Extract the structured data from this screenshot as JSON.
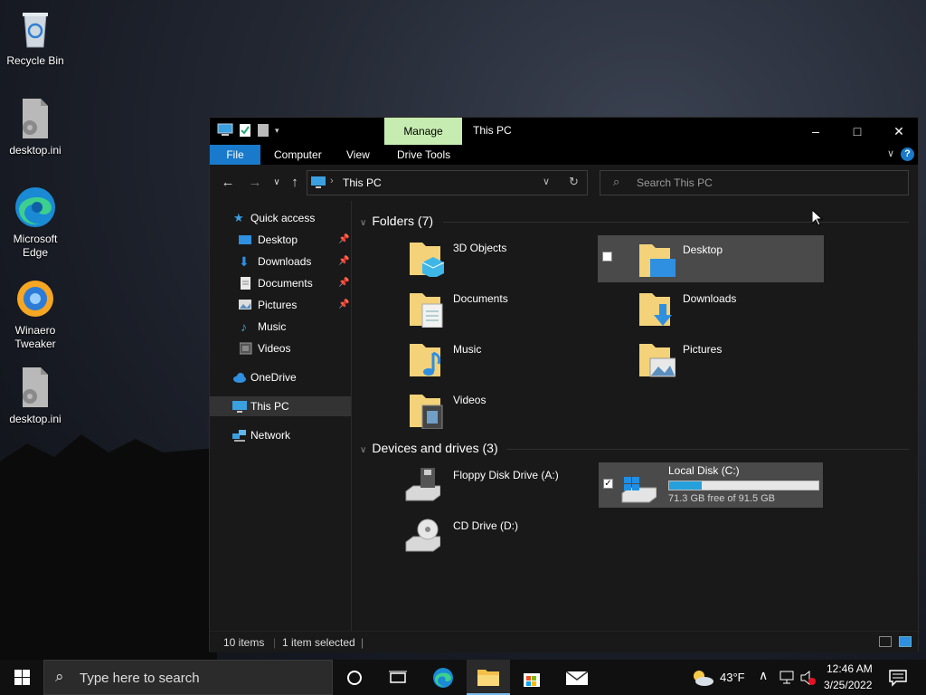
{
  "desktop": {
    "icons": [
      {
        "label": "Recycle Bin",
        "icon": "recycle-bin-icon"
      },
      {
        "label": "desktop.ini",
        "icon": "settings-file-icon"
      },
      {
        "label": "Microsoft Edge",
        "icon": "edge-icon"
      },
      {
        "label": "Winaero Tweaker",
        "icon": "winaero-icon"
      },
      {
        "label": "desktop.ini",
        "icon": "settings-file-icon"
      }
    ]
  },
  "window": {
    "context_tab": "Manage",
    "title": "This PC",
    "ribbon_tabs": [
      "File",
      "Computer",
      "View",
      "Drive Tools"
    ],
    "help_label": "?",
    "address": "This PC",
    "search_placeholder": "Search This PC"
  },
  "navpane": {
    "quick_access": "Quick access",
    "quick_items": [
      {
        "label": "Desktop",
        "pinned": true
      },
      {
        "label": "Downloads",
        "pinned": true
      },
      {
        "label": "Documents",
        "pinned": true
      },
      {
        "label": "Pictures",
        "pinned": true
      },
      {
        "label": "Music",
        "pinned": false
      },
      {
        "label": "Videos",
        "pinned": false
      }
    ],
    "onedrive": "OneDrive",
    "this_pc": "This PC",
    "network": "Network"
  },
  "content": {
    "folders_header": "Folders (7)",
    "folders": [
      "3D Objects",
      "Desktop",
      "Documents",
      "Downloads",
      "Music",
      "Pictures",
      "Videos"
    ],
    "selected_folder": "Desktop",
    "drives_header": "Devices and drives (3)",
    "drives": [
      {
        "label": "Floppy Disk Drive (A:)"
      },
      {
        "label": "Local Disk (C:)",
        "free_text": "71.3 GB free of 91.5 GB",
        "used_fraction": 0.22,
        "selected": true
      },
      {
        "label": "CD Drive (D:)"
      }
    ]
  },
  "status": {
    "items": "10 items",
    "selected": "1 item selected"
  },
  "taskbar": {
    "search_placeholder": "Type here to search",
    "weather": "43°F",
    "time": "12:46 AM",
    "date": "3/25/2022"
  },
  "colors": {
    "accent": "#1979ca",
    "context_tab": "#c7ecb1",
    "drive_fill": "#26a0da",
    "folder": "#f3d279"
  }
}
